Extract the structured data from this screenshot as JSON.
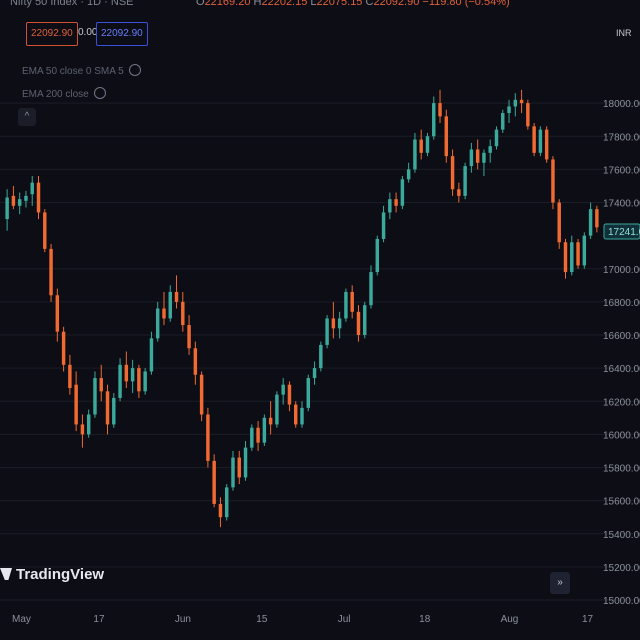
{
  "header": {
    "symbol": "Nifty 50 Index · 1D · NSE",
    "ohlc": [
      {
        "k": "O",
        "v": "22169.20"
      },
      {
        "k": "H",
        "v": "22202.15"
      },
      {
        "k": "L",
        "v": "22075.15"
      },
      {
        "k": "C",
        "v": "22092.90"
      }
    ],
    "change": "−119.80 (−0.54%)",
    "sell_price": "22092.90",
    "spread": "0.00",
    "buy_price": "22092.90",
    "indicator_1": "EMA 50 close 0 SMA 5",
    "indicator_2": "EMA 200 close",
    "collapse_icon": "^",
    "currency": "INR"
  },
  "branding": {
    "logo_text": "TradingView"
  },
  "scroll_button_icon": "»",
  "last_price_label": "17241.00",
  "colors": {
    "up": "#3ba99c",
    "down": "#f06a32",
    "background": "#0d0e15",
    "grid": "#1a1c26"
  },
  "chart_data": {
    "type": "candlestick",
    "y_ticks": [
      "18000.00",
      "17800.00",
      "17600.00",
      "17400.00",
      "17000.00",
      "16800.00",
      "16600.00",
      "16400.00",
      "16200.00",
      "16000.00",
      "15800.00",
      "15600.00",
      "15400.00",
      "15200.00",
      "15000.00"
    ],
    "x_ticks": [
      "May",
      "17",
      "Jun",
      "15",
      "Jul",
      "18",
      "Aug",
      "17"
    ],
    "ylim": [
      15000,
      18200
    ],
    "candles": [
      [
        17300,
        17480,
        17230,
        17430
      ],
      [
        17440,
        17500,
        17360,
        17380
      ],
      [
        17380,
        17460,
        17330,
        17420
      ],
      [
        17410,
        17470,
        17370,
        17440
      ],
      [
        17450,
        17560,
        17380,
        17520
      ],
      [
        17520,
        17560,
        17300,
        17340
      ],
      [
        17340,
        17360,
        17100,
        17120
      ],
      [
        17120,
        17150,
        16800,
        16840
      ],
      [
        16840,
        16880,
        16560,
        16620
      ],
      [
        16620,
        16650,
        16380,
        16420
      ],
      [
        16420,
        16480,
        16240,
        16280
      ],
      [
        16300,
        16380,
        16020,
        16060
      ],
      [
        16060,
        16120,
        15920,
        16000
      ],
      [
        16000,
        16150,
        15980,
        16120
      ],
      [
        16120,
        16380,
        16100,
        16340
      ],
      [
        16340,
        16420,
        16200,
        16260
      ],
      [
        16260,
        16300,
        16000,
        16060
      ],
      [
        16060,
        16250,
        16040,
        16220
      ],
      [
        16220,
        16460,
        16200,
        16420
      ],
      [
        16420,
        16500,
        16280,
        16320
      ],
      [
        16320,
        16450,
        16250,
        16400
      ],
      [
        16400,
        16420,
        16220,
        16260
      ],
      [
        16260,
        16400,
        16240,
        16380
      ],
      [
        16380,
        16620,
        16360,
        16580
      ],
      [
        16580,
        16800,
        16560,
        16760
      ],
      [
        16760,
        16860,
        16660,
        16700
      ],
      [
        16700,
        16900,
        16680,
        16860
      ],
      [
        16860,
        16960,
        16760,
        16800
      ],
      [
        16800,
        16860,
        16620,
        16660
      ],
      [
        16660,
        16720,
        16480,
        16520
      ],
      [
        16520,
        16560,
        16300,
        16360
      ],
      [
        16360,
        16380,
        16080,
        16120
      ],
      [
        16120,
        16160,
        15800,
        15840
      ],
      [
        15840,
        15880,
        15560,
        15580
      ],
      [
        15580,
        15620,
        15440,
        15500
      ],
      [
        15500,
        15700,
        15480,
        15680
      ],
      [
        15680,
        15900,
        15660,
        15860
      ],
      [
        15860,
        15900,
        15700,
        15740
      ],
      [
        15740,
        15960,
        15720,
        15920
      ],
      [
        15920,
        16060,
        15900,
        16040
      ],
      [
        16040,
        16080,
        15900,
        15950
      ],
      [
        15950,
        16120,
        15930,
        16100
      ],
      [
        16100,
        16200,
        16000,
        16060
      ],
      [
        16060,
        16260,
        16040,
        16240
      ],
      [
        16240,
        16340,
        16180,
        16300
      ],
      [
        16300,
        16320,
        16140,
        16180
      ],
      [
        16180,
        16200,
        16040,
        16060
      ],
      [
        16060,
        16200,
        16040,
        16160
      ],
      [
        16160,
        16360,
        16140,
        16340
      ],
      [
        16340,
        16440,
        16300,
        16400
      ],
      [
        16400,
        16560,
        16380,
        16540
      ],
      [
        16540,
        16720,
        16520,
        16700
      ],
      [
        16700,
        16800,
        16580,
        16640
      ],
      [
        16640,
        16740,
        16580,
        16700
      ],
      [
        16700,
        16880,
        16680,
        16860
      ],
      [
        16860,
        16900,
        16700,
        16740
      ],
      [
        16740,
        16780,
        16560,
        16600
      ],
      [
        16600,
        16800,
        16580,
        16780
      ],
      [
        16780,
        17020,
        16760,
        16980
      ],
      [
        16980,
        17200,
        16960,
        17180
      ],
      [
        17180,
        17380,
        17160,
        17340
      ],
      [
        17340,
        17460,
        17300,
        17420
      ],
      [
        17420,
        17460,
        17340,
        17380
      ],
      [
        17380,
        17560,
        17360,
        17540
      ],
      [
        17540,
        17640,
        17520,
        17600
      ],
      [
        17600,
        17820,
        17580,
        17780
      ],
      [
        17780,
        17840,
        17660,
        17700
      ],
      [
        17700,
        17820,
        17680,
        17800
      ],
      [
        17800,
        18040,
        17780,
        18000
      ],
      [
        18000,
        18080,
        17880,
        17920
      ],
      [
        17920,
        17960,
        17640,
        17680
      ],
      [
        17680,
        17720,
        17440,
        17480
      ],
      [
        17480,
        17520,
        17400,
        17440
      ],
      [
        17440,
        17640,
        17420,
        17620
      ],
      [
        17620,
        17760,
        17580,
        17720
      ],
      [
        17720,
        17780,
        17600,
        17640
      ],
      [
        17640,
        17720,
        17560,
        17700
      ],
      [
        17700,
        17780,
        17640,
        17740
      ],
      [
        17740,
        17860,
        17720,
        17840
      ],
      [
        17840,
        17960,
        17820,
        17940
      ],
      [
        17940,
        18020,
        17880,
        17980
      ],
      [
        17980,
        18060,
        17920,
        18020
      ],
      [
        18020,
        18080,
        17940,
        18000
      ],
      [
        18000,
        18020,
        17840,
        17860
      ],
      [
        17860,
        17880,
        17680,
        17700
      ],
      [
        17700,
        17860,
        17680,
        17840
      ],
      [
        17840,
        17860,
        17640,
        17660
      ],
      [
        17660,
        17680,
        17360,
        17400
      ],
      [
        17400,
        17420,
        17120,
        17160
      ],
      [
        17160,
        17180,
        16940,
        16980
      ],
      [
        16980,
        17200,
        16960,
        17160
      ],
      [
        17160,
        17180,
        17000,
        17020
      ],
      [
        17020,
        17220,
        17000,
        17200
      ],
      [
        17200,
        17400,
        17180,
        17360
      ],
      [
        17360,
        17380,
        17220,
        17250
      ]
    ]
  }
}
